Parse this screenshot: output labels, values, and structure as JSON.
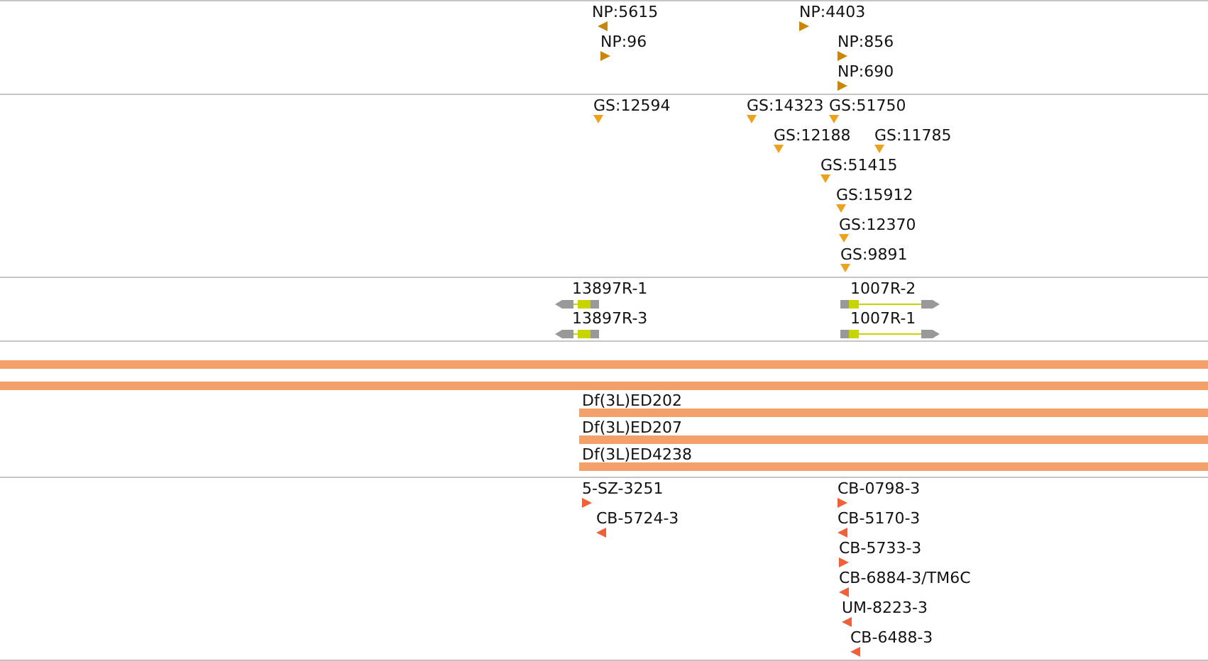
{
  "tracks": [
    {
      "kind": "markers",
      "features": [
        {
          "label": "NP:5615",
          "kind": "reverse"
        },
        {
          "label": "NP:96",
          "kind": "forward"
        },
        {
          "label": "NP:4403",
          "kind": "forward"
        },
        {
          "label": "NP:856",
          "kind": "forward"
        },
        {
          "label": "NP:690",
          "kind": "forward"
        }
      ]
    },
    {
      "kind": "markers",
      "features": [
        {
          "label": "GS:12594",
          "kind": "point"
        },
        {
          "label": "GS:14323",
          "kind": "point"
        },
        {
          "label": "GS:51750",
          "kind": "point"
        },
        {
          "label": "GS:12188",
          "kind": "point"
        },
        {
          "label": "GS:11785",
          "kind": "point"
        },
        {
          "label": "GS:51415",
          "kind": "point"
        },
        {
          "label": "GS:15912",
          "kind": "point"
        },
        {
          "label": "GS:12370",
          "kind": "point"
        },
        {
          "label": "GS:9891",
          "kind": "point"
        }
      ]
    },
    {
      "kind": "genes",
      "features": [
        {
          "label": "13897R-1",
          "kind": "reverse"
        },
        {
          "label": "13897R-3",
          "kind": "reverse"
        },
        {
          "label": "1007R-2",
          "kind": "forward"
        },
        {
          "label": "1007R-1",
          "kind": "forward"
        }
      ]
    },
    {
      "kind": "bars",
      "features": [
        {
          "kind": "full"
        },
        {
          "kind": "full"
        },
        {
          "kind": "labeled",
          "label": "Df(3L)ED202"
        },
        {
          "kind": "labeled",
          "label": "Df(3L)ED207"
        },
        {
          "kind": "labeled",
          "label": "Df(3L)ED4238"
        }
      ]
    },
    {
      "kind": "markers",
      "features": [
        {
          "label": "5-SZ-3251",
          "kind": "forward"
        },
        {
          "label": "CB-5724-3",
          "kind": "reverse"
        },
        {
          "label": "CB-0798-3",
          "kind": "forward"
        },
        {
          "label": "CB-5170-3",
          "kind": "reverse"
        },
        {
          "label": "CB-5733-3",
          "kind": "forward"
        },
        {
          "label": "CB-6884-3/TM6C",
          "kind": "reverse"
        },
        {
          "label": "UM-8223-3",
          "kind": "reverse"
        },
        {
          "label": "CB-6488-3",
          "kind": "reverse"
        }
      ]
    }
  ]
}
